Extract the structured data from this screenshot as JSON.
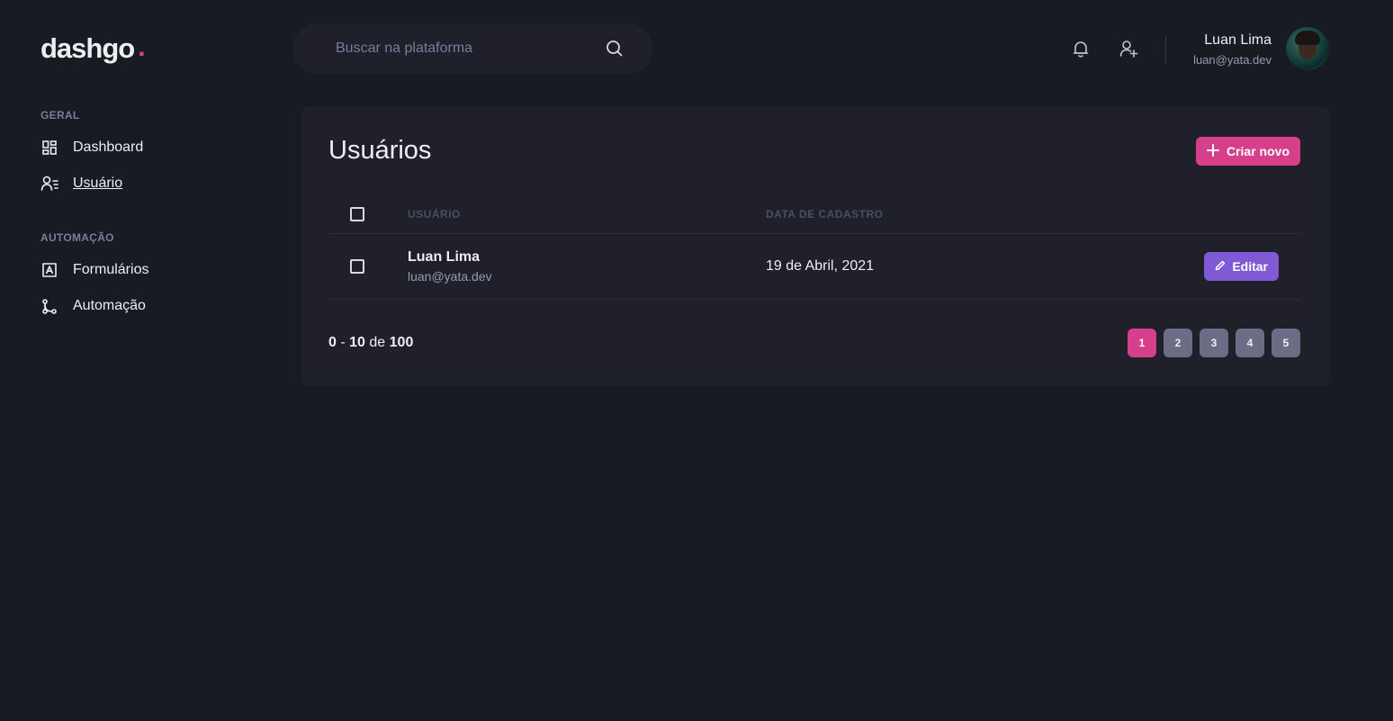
{
  "brand": {
    "name": "dashgo",
    "dot": "."
  },
  "search": {
    "placeholder": "Buscar na plataforma"
  },
  "header": {
    "notification_icon": "bell-icon",
    "add_user_icon": "user-add-icon"
  },
  "profile": {
    "name": "Luan Lima",
    "email": "luan@yata.dev"
  },
  "sidebar": {
    "sections": [
      {
        "title": "GERAL",
        "items": [
          {
            "label": "Dashboard",
            "icon": "dashboard-icon"
          },
          {
            "label": "Usuário",
            "icon": "users-icon",
            "active": true
          }
        ]
      },
      {
        "title": "AUTOMAÇÃO",
        "items": [
          {
            "label": "Formulários",
            "icon": "form-icon"
          },
          {
            "label": "Automação",
            "icon": "git-merge-icon"
          }
        ]
      }
    ]
  },
  "main": {
    "title": "Usuários",
    "create_label": "Criar novo",
    "table": {
      "headers": {
        "user": "USUÁRIO",
        "date": "DATA DE CADASTRO"
      },
      "rows": [
        {
          "name": "Luan Lima",
          "email": "luan@yata.dev",
          "date": "19 de Abril, 2021",
          "action": "Editar"
        }
      ]
    },
    "pagination": {
      "from": "0",
      "sep": "-",
      "to": "10",
      "de": "de",
      "total": "100",
      "pages": [
        "1",
        "2",
        "3",
        "4",
        "5"
      ],
      "current": "1"
    }
  },
  "colors": {
    "background": "#181b21",
    "card": "#1f2029",
    "accent_pink": "#d53f8c",
    "accent_purple": "#805ad5",
    "page_inactive": "#6b6d87"
  }
}
